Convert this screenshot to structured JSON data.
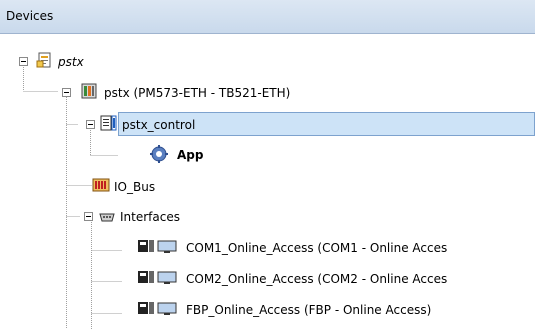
{
  "header": {
    "title": "Devices"
  },
  "tree": {
    "project": {
      "label": "pstx",
      "icon": "project-file-icon"
    },
    "device": {
      "label": "pstx (PM573-ETH - TB521-ETH)",
      "icon": "plc-device-icon"
    },
    "control": {
      "label": "pstx_control",
      "icon": "plc-logic-icon",
      "selected": true
    },
    "app": {
      "label": "App",
      "icon": "gear-icon"
    },
    "io_bus": {
      "label": "IO_Bus",
      "icon": "io-bus-icon"
    },
    "interfaces": {
      "label": "Interfaces",
      "icon": "interface-connector-icon"
    },
    "com1": {
      "label": "COM1_Online_Access (COM1 - Online Acces",
      "icon": "online-access-icon"
    },
    "com2": {
      "label": "COM2_Online_Access (COM2 - Online Acces",
      "icon": "online-access-icon"
    },
    "fbp": {
      "label": "FBP_Online_Access (FBP - Online Access)",
      "icon": "online-access-icon"
    }
  },
  "colors": {
    "header_bg": "#c9d9ec",
    "selection_bg": "#cde3f7",
    "selection_border": "#7da2ce"
  }
}
